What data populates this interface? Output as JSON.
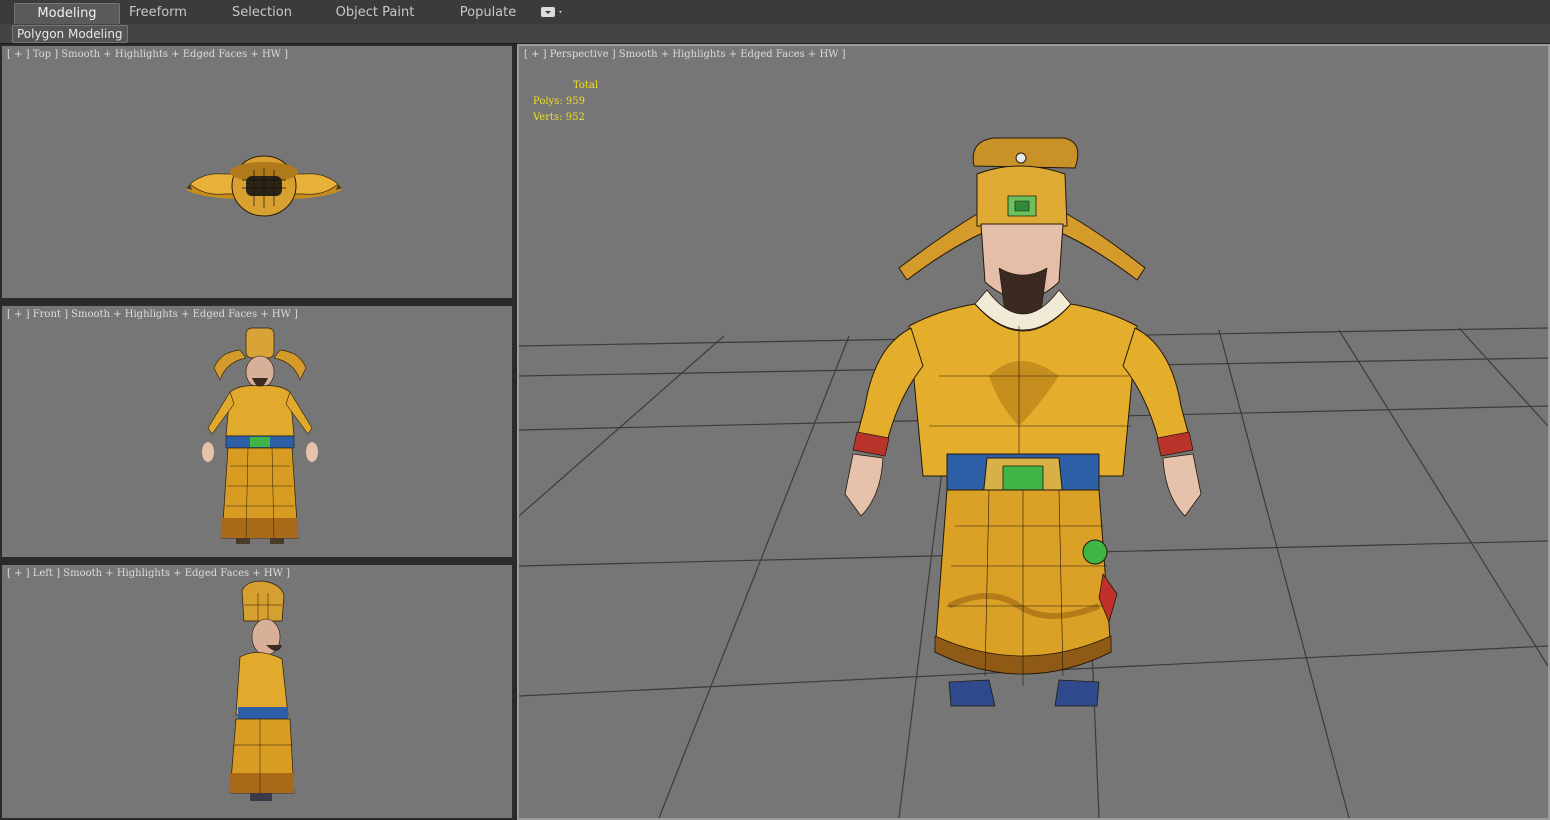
{
  "ribbon": {
    "tabs": [
      {
        "label": "Modeling",
        "active": true
      },
      {
        "label": "Freeform",
        "active": false
      },
      {
        "label": "Selection",
        "active": false
      },
      {
        "label": "Object Paint",
        "active": false
      },
      {
        "label": "Populate",
        "active": false
      }
    ],
    "options_icon": "dropdown-options-icon",
    "panel_label": "Polygon Modeling"
  },
  "viewports": {
    "top": {
      "label": "[ + ] Top ] Smooth + Highlights + Edged Faces + HW ]"
    },
    "front": {
      "label": "[ + ] Front ] Smooth + Highlights + Edged Faces + HW ]"
    },
    "left": {
      "label": "[ + ] Left ] Smooth + Highlights + Edged Faces + HW ]"
    },
    "perspective": {
      "label": "[ + ] Perspective ] Smooth + Highlights + Edged Faces + HW ]",
      "stats": {
        "header": "Total",
        "polys_label": "Polys:",
        "polys_value": "959",
        "verts_label": "Verts:",
        "verts_value": "952"
      }
    }
  },
  "colors": {
    "viewport_bg": "#767676",
    "stats_text": "#f0e020",
    "robe_gold": "#e3a924",
    "belt_blue": "#2c5fa6",
    "jade_green": "#3fb548"
  }
}
